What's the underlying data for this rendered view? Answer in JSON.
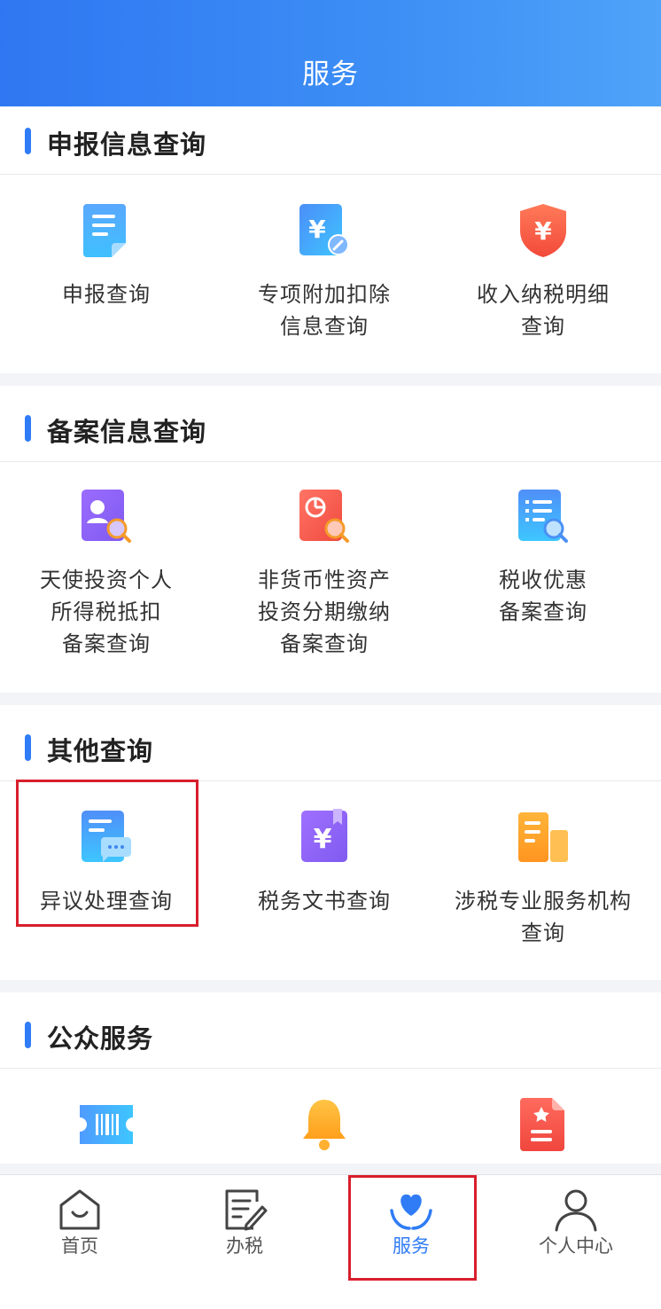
{
  "header": {
    "title": "服务"
  },
  "sections": [
    {
      "title": "申报信息查询",
      "items": [
        {
          "line1": "申报查询",
          "line2": "",
          "line3": "",
          "icon": "document-icon"
        },
        {
          "line1": "专项附加扣除",
          "line2": "信息查询",
          "line3": "",
          "icon": "yuan-edit-icon"
        },
        {
          "line1": "收入纳税明细",
          "line2": "查询",
          "line3": "",
          "icon": "yuan-shield-icon"
        }
      ]
    },
    {
      "title": "备案信息查询",
      "items": [
        {
          "line1": "天使投资个人",
          "line2": "所得税抵扣",
          "line3": "备案查询",
          "icon": "person-search-icon"
        },
        {
          "line1": "非货币性资产",
          "line2": "投资分期缴纳",
          "line3": "备案查询",
          "icon": "pie-search-icon"
        },
        {
          "line1": "税收优惠",
          "line2": "备案查询",
          "line3": "",
          "icon": "list-search-icon"
        }
      ]
    },
    {
      "title": "其他查询",
      "items": [
        {
          "line1": "异议处理查询",
          "line2": "",
          "line3": "",
          "icon": "chat-document-icon"
        },
        {
          "line1": "税务文书查询",
          "line2": "",
          "line3": "",
          "icon": "yuan-book-icon"
        },
        {
          "line1": "涉税专业服务机构",
          "line2": "查询",
          "line3": "",
          "icon": "building-icon"
        }
      ]
    },
    {
      "title": "公众服务",
      "items": [
        {
          "icon": "ticket-barcode-icon"
        },
        {
          "icon": "bell-icon"
        },
        {
          "icon": "star-document-icon"
        }
      ]
    }
  ],
  "tabbar": {
    "tabs": [
      {
        "label": "首页",
        "icon": "home-icon"
      },
      {
        "label": "办税",
        "icon": "edit-form-icon"
      },
      {
        "label": "服务",
        "icon": "heart-hands-icon",
        "active": true
      },
      {
        "label": "个人中心",
        "icon": "user-icon"
      }
    ]
  },
  "colors": {
    "header_start": "#2f77f2",
    "header_end": "#4fa3f8",
    "accent": "#2f7cf6",
    "highlight_box": "#d81e2c",
    "section_gap": "#f3f4f7"
  }
}
